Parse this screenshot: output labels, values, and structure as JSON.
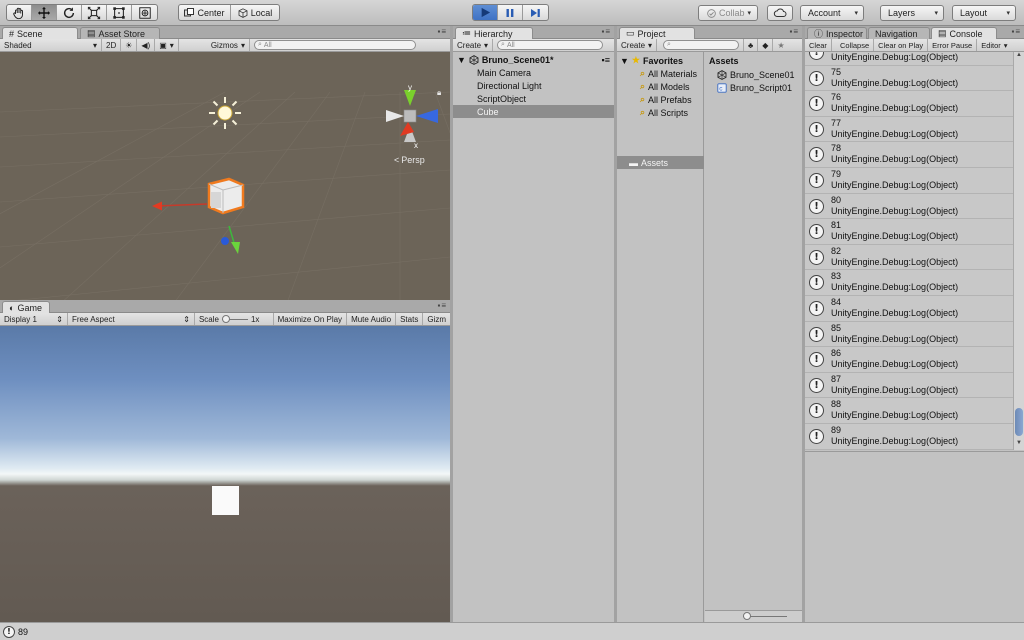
{
  "toolbar": {
    "tools": [
      {
        "name": "hand-tool",
        "icon": "hand-icon"
      },
      {
        "name": "move-tool",
        "icon": "move-icon"
      },
      {
        "name": "rotate-tool",
        "icon": "rotate-icon"
      },
      {
        "name": "scale-tool",
        "icon": "scale-icon"
      },
      {
        "name": "rect-tool",
        "icon": "rect-icon"
      },
      {
        "name": "transform-tool",
        "icon": "transform-icon"
      }
    ],
    "pivot_center": "Center",
    "pivot_local": "Local",
    "collab": "Collab",
    "account": "Account",
    "layers": "Layers",
    "layout": "Layout"
  },
  "scene": {
    "tab_scene": "Scene",
    "tab_asset_store": "Asset Store",
    "shaded": "Shaded",
    "mode_2d": "2D",
    "gizmos": "Gizmos",
    "search_placeholder": "All",
    "persp": "Persp",
    "axis_y": "y",
    "axis_x": "x"
  },
  "game": {
    "tab": "Game",
    "display": "Display 1",
    "aspect": "Free Aspect",
    "scale_label": "Scale",
    "scale_value": "1x",
    "maximize": "Maximize On Play",
    "mute": "Mute Audio",
    "stats": "Stats",
    "gizmos": "Gizm"
  },
  "hierarchy": {
    "tab": "Hierarchy",
    "create": "Create",
    "search_placeholder": "All",
    "scene_name": "Bruno_Scene01*",
    "items": [
      {
        "label": "Main Camera",
        "selected": false
      },
      {
        "label": "Directional Light",
        "selected": false
      },
      {
        "label": "ScriptObject",
        "selected": false
      },
      {
        "label": "Cube",
        "selected": true
      }
    ]
  },
  "project": {
    "tab": "Project",
    "create": "Create",
    "favorites": "Favorites",
    "favorite_items": [
      "All Materials",
      "All Models",
      "All Prefabs",
      "All Scripts"
    ],
    "assets_folder": "Assets",
    "assets_header": "Assets",
    "asset_items": [
      {
        "label": "Bruno_Scene01",
        "icon": "unity-scene-icon"
      },
      {
        "label": "Bruno_Script01",
        "icon": "csharp-script-icon"
      }
    ]
  },
  "console": {
    "tab_inspector": "Inspector",
    "tab_navigation": "Navigation",
    "tab_console": "Console",
    "clear": "Clear",
    "collapse": "Collapse",
    "clear_on_play": "Clear on Play",
    "error_pause": "Error Pause",
    "editor": "Editor",
    "logs": [
      {
        "count": "",
        "message": "UnityEngine.Debug:Log(Object)"
      },
      {
        "count": "75",
        "message": "UnityEngine.Debug:Log(Object)"
      },
      {
        "count": "76",
        "message": "UnityEngine.Debug:Log(Object)"
      },
      {
        "count": "77",
        "message": "UnityEngine.Debug:Log(Object)"
      },
      {
        "count": "78",
        "message": "UnityEngine.Debug:Log(Object)"
      },
      {
        "count": "79",
        "message": "UnityEngine.Debug:Log(Object)"
      },
      {
        "count": "80",
        "message": "UnityEngine.Debug:Log(Object)"
      },
      {
        "count": "81",
        "message": "UnityEngine.Debug:Log(Object)"
      },
      {
        "count": "82",
        "message": "UnityEngine.Debug:Log(Object)"
      },
      {
        "count": "83",
        "message": "UnityEngine.Debug:Log(Object)"
      },
      {
        "count": "84",
        "message": "UnityEngine.Debug:Log(Object)"
      },
      {
        "count": "85",
        "message": "UnityEngine.Debug:Log(Object)"
      },
      {
        "count": "86",
        "message": "UnityEngine.Debug:Log(Object)"
      },
      {
        "count": "87",
        "message": "UnityEngine.Debug:Log(Object)"
      },
      {
        "count": "88",
        "message": "UnityEngine.Debug:Log(Object)"
      },
      {
        "count": "89",
        "message": "UnityEngine.Debug:Log(Object)"
      }
    ]
  },
  "status": {
    "last_log": "89"
  },
  "colors": {
    "play_blue": "#3f72c4",
    "selection": "#8d8d8d",
    "scene_bg": "#6c6458",
    "cube_outline": "#f07a1e"
  }
}
